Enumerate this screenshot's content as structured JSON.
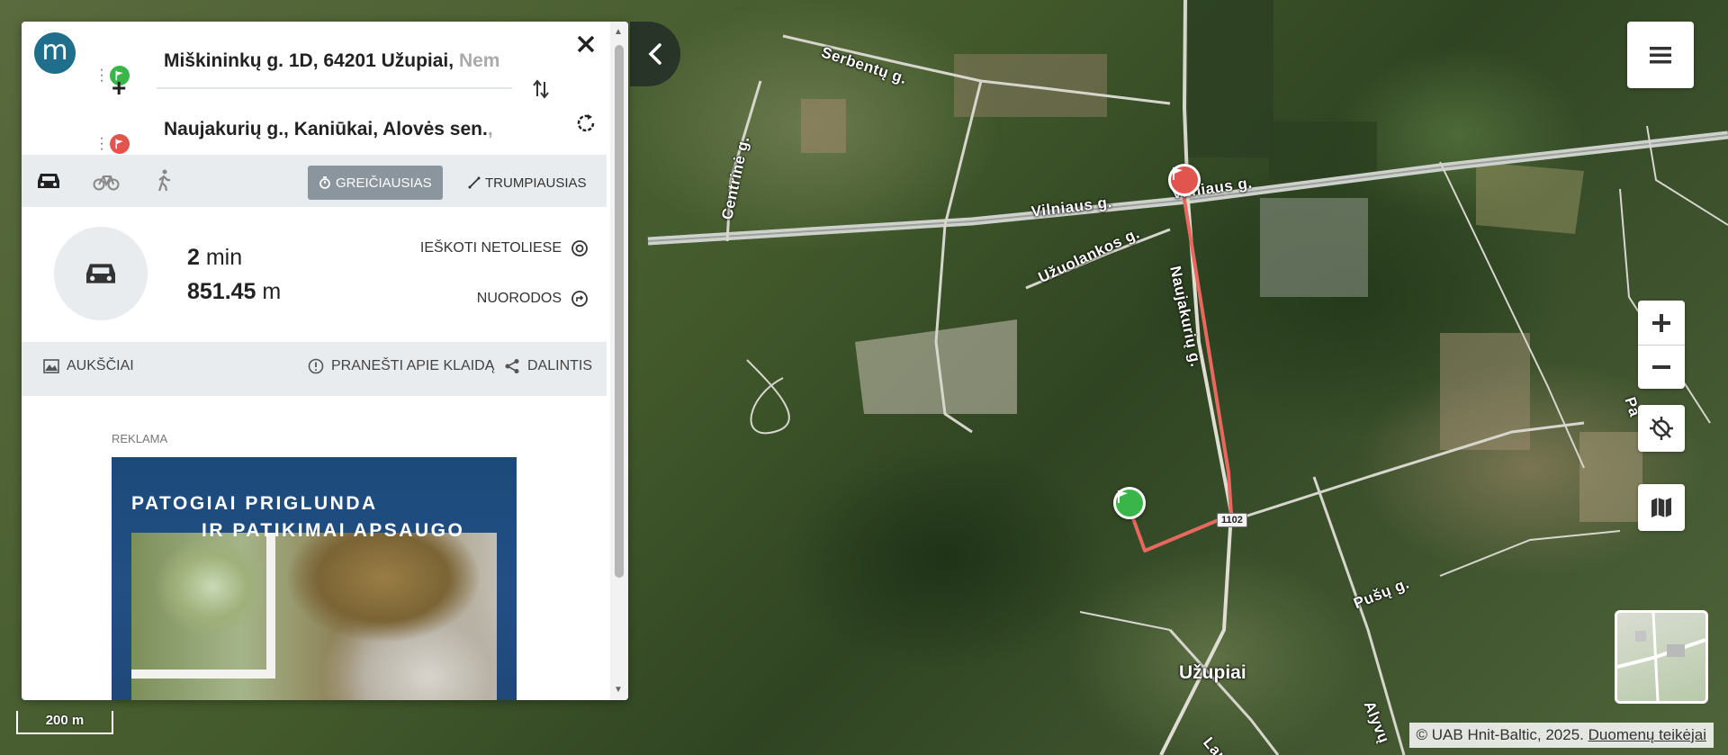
{
  "panel": {
    "logo_letter": "m",
    "origin": {
      "bold": "Miškininkų g. 1D, 64201 Užupiai, ",
      "faded": "Nem"
    },
    "destination": {
      "bold": "Naujakurių g., Kaniūkai, Alovės sen.",
      "faded": ","
    },
    "add_stop": "+",
    "modes": [
      "car-icon",
      "bicycle-icon",
      "walk-icon"
    ],
    "active_mode": "car",
    "route_options": {
      "fastest": "GREIČIAUSIAS",
      "shortest": "TRUMPIAUSIAS",
      "selected": "fastest"
    },
    "summary": {
      "time_value": "2",
      "time_unit": "min",
      "distance_value": "851.45",
      "distance_unit": "m",
      "search_nearby": "IEŠKOTI NETOLIESE",
      "directions": "NUORODOS"
    },
    "actions": {
      "elevation": "AUKŠČIAI",
      "report": "PRANEŠTI APIE KLAIDĄ",
      "share": "DALINTIS"
    },
    "ad": {
      "label": "REKLAMA",
      "line1": "PATOGIAI PRIGLUNDA",
      "line2": "IR PATIKIMAI APSAUGO"
    }
  },
  "map": {
    "road_labels": [
      "Serbentų g.",
      "Centrinė g.",
      "Vilniaus g.",
      "Vilniaus g.",
      "Užuolankos g.",
      "Naujakurių g.",
      "Pušų g.",
      "Alyvų",
      "Lauk",
      "Pa"
    ],
    "place_label": "Užupiai",
    "road_shield": "1102",
    "scale_label": "200 m",
    "attribution": "© UAB Hnit-Baltic, 2025.",
    "attribution_link": "Duomenų teikėjai",
    "route_color": "#e8685f",
    "start_marker_color": "#39b54a",
    "end_marker_color": "#e2554f"
  },
  "colors": {
    "brand": "#1e6e8c",
    "toolbar_bg": "#e8ecef",
    "active_option": "#8a959e"
  }
}
